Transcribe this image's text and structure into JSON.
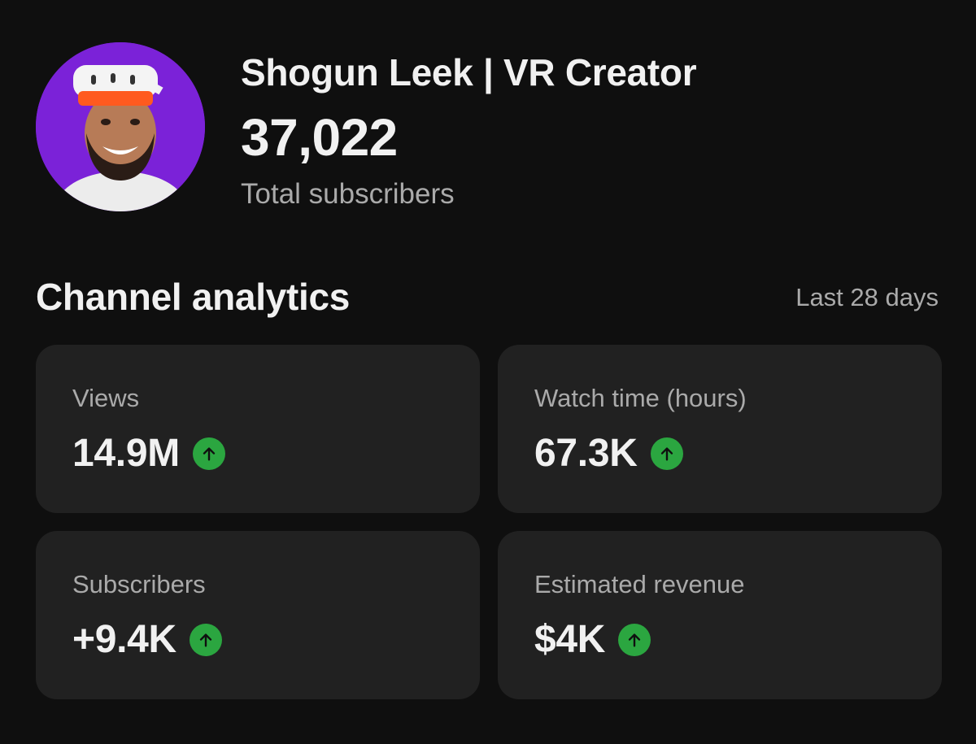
{
  "channel": {
    "name": "Shogun Leek | VR Creator",
    "subscriber_count": "37,022",
    "subscriber_label": "Total subscribers",
    "avatar": "channel-avatar"
  },
  "analytics": {
    "title": "Channel analytics",
    "period": "Last 28 days",
    "trend_color": "#2ba640",
    "cards": [
      {
        "label": "Views",
        "value": "14.9M",
        "trend": "up-arrow-icon"
      },
      {
        "label": "Watch time (hours)",
        "value": "67.3K",
        "trend": "up-arrow-icon"
      },
      {
        "label": "Subscribers",
        "value": "+9.4K",
        "trend": "up-arrow-icon"
      },
      {
        "label": "Estimated revenue",
        "value": "$4K",
        "trend": "up-arrow-icon"
      }
    ]
  }
}
